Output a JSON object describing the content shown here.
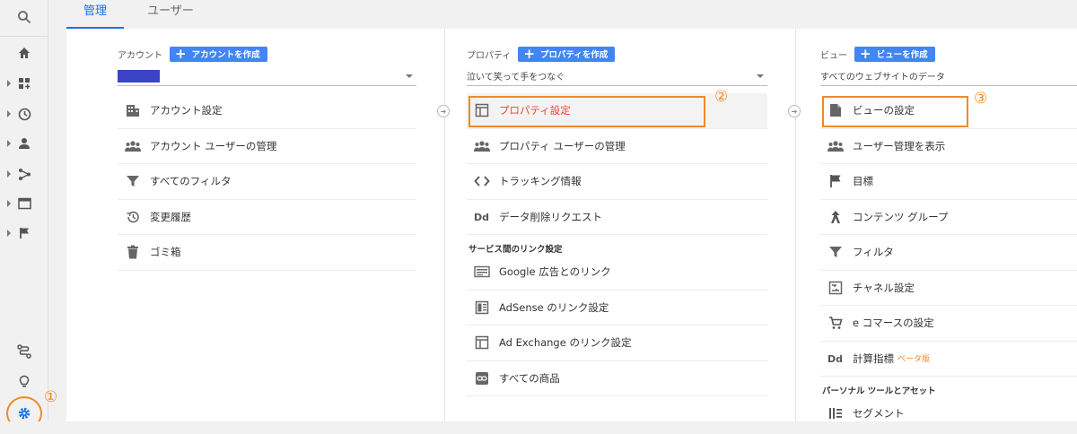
{
  "tabs": {
    "admin": "管理",
    "users": "ユーザー"
  },
  "account": {
    "label": "アカウント",
    "create_button": "アカウントを作成",
    "items": [
      "アカウント設定",
      "アカウント ユーザーの管理",
      "すべてのフィルタ",
      "変更履歴",
      "ゴミ箱"
    ]
  },
  "property": {
    "label": "プロパティ",
    "create_button": "プロパティを作成",
    "selected": "泣いて笑って手をつなぐ",
    "items": [
      "プロパティ設定",
      "プロパティ ユーザーの管理",
      "トラッキング情報",
      "データ削除リクエスト"
    ],
    "section_title": "サービス間のリンク設定",
    "link_items": [
      "Google 広告とのリンク",
      "AdSense のリンク設定",
      "Ad Exchange のリンク設定",
      "すべての商品"
    ]
  },
  "view": {
    "label": "ビュー",
    "create_button": "ビューを作成",
    "selected": "すべてのウェブサイトのデータ",
    "items": [
      "ビューの設定",
      "ユーザー管理を表示",
      "目標",
      "コンテンツ グループ",
      "フィルタ",
      "チャネル設定",
      "e コマースの設定",
      "計算指標"
    ],
    "beta_label": "ベータ版",
    "section_title": "パーソナル ツールとアセット",
    "personal_items": [
      "セグメント"
    ]
  },
  "markers": {
    "one": "①",
    "two": "②",
    "three": "③"
  },
  "colors": {
    "accent": "#1a73e8",
    "highlight": "#f08a24",
    "create_button": "#4285f4",
    "selected_text": "#e8453c"
  }
}
